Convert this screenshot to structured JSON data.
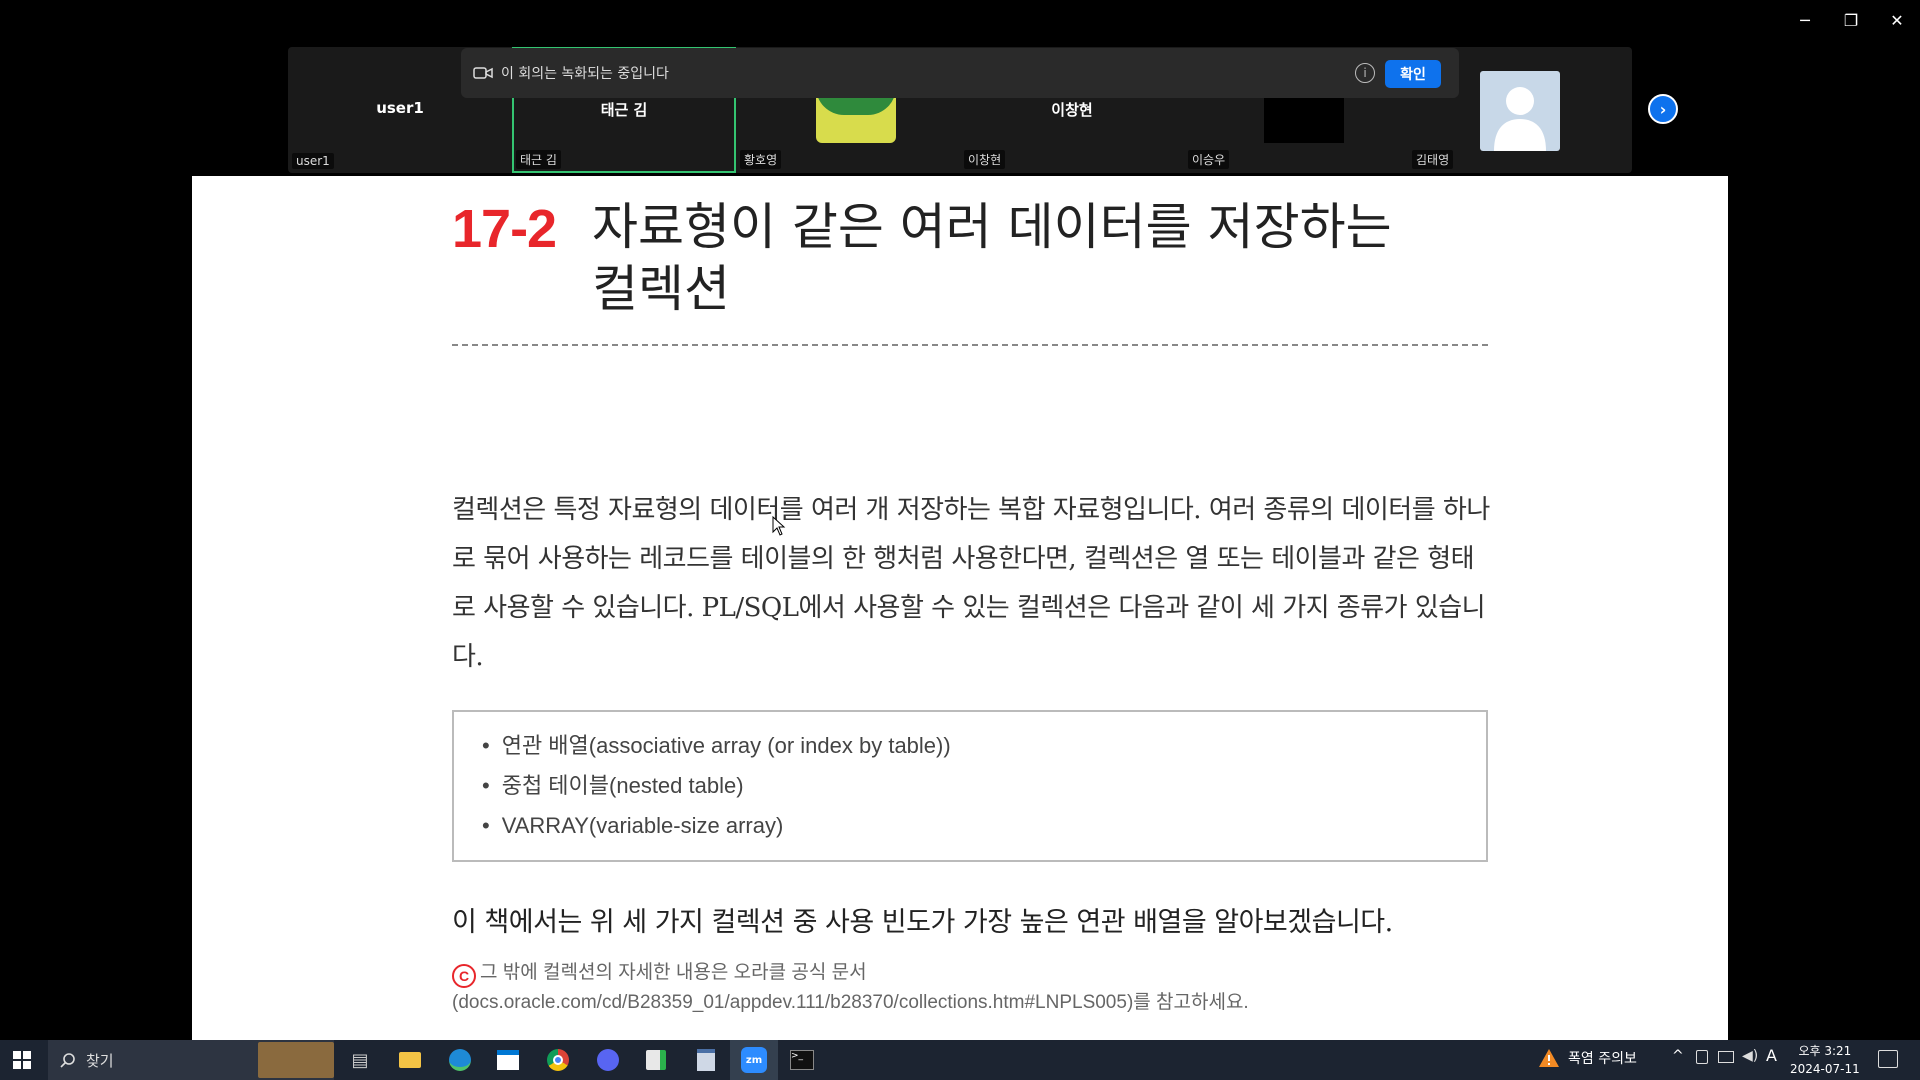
{
  "window": {
    "controls": [
      "─",
      "❐",
      "✕"
    ]
  },
  "recording_banner": {
    "text": "이 회의는 녹화되는 중입니다",
    "info": "i",
    "ok_label": "확인"
  },
  "participants": [
    {
      "center": "user1",
      "tag": "user1"
    },
    {
      "center": "태근 김",
      "tag": "태근 김",
      "active": true
    },
    {
      "center": "",
      "tag": "황호영"
    },
    {
      "center": "이창현",
      "tag": "이창현"
    },
    {
      "center": "",
      "tag": "이승우"
    },
    {
      "center": "",
      "tag": "김태영"
    }
  ],
  "next_label": "›",
  "doc": {
    "chapter_number": "17-2",
    "chapter_title_line1": "자료형이 같은 여러 데이터를 저장하는",
    "chapter_title_line2": "컬렉션",
    "paragraph": "컬렉션은 특정 자료형의 데이터를 여러 개 저장하는 복합 자료형입니다. 여러 종류의 데이터를 하나로 묶어 사용하는 레코드를 테이블의 한 행처럼 사용한다면, 컬렉션은 열 또는 테이블과 같은 형태로 사용할 수 있습니다. PL/SQL에서 사용할 수 있는 컬렉션은 다음과 같이 세 가지 종류가 있습니다.",
    "list": [
      "연관 배열(associative array (or index by table))",
      "중첩 테이블(nested table)",
      "VARRAY(variable-size array)"
    ],
    "summary": "이 책에서는 위 세 가지 컬렉션 중 사용 빈도가 가장 높은 연관 배열을 알아보겠습니다.",
    "note_icon": "C",
    "note": "그 밖에 컬렉션의 자세한 내용은 오라클 공식 문서(docs.oracle.com/cd/B28359_01/appdev.111/b28370/collections.htm#LNPLS005)를 참고하세요."
  },
  "taskbar": {
    "search_placeholder": "찾기",
    "weather": "폭염 주의보",
    "time": "오후 3:21",
    "date": "2024-07-11",
    "ime": "A"
  }
}
